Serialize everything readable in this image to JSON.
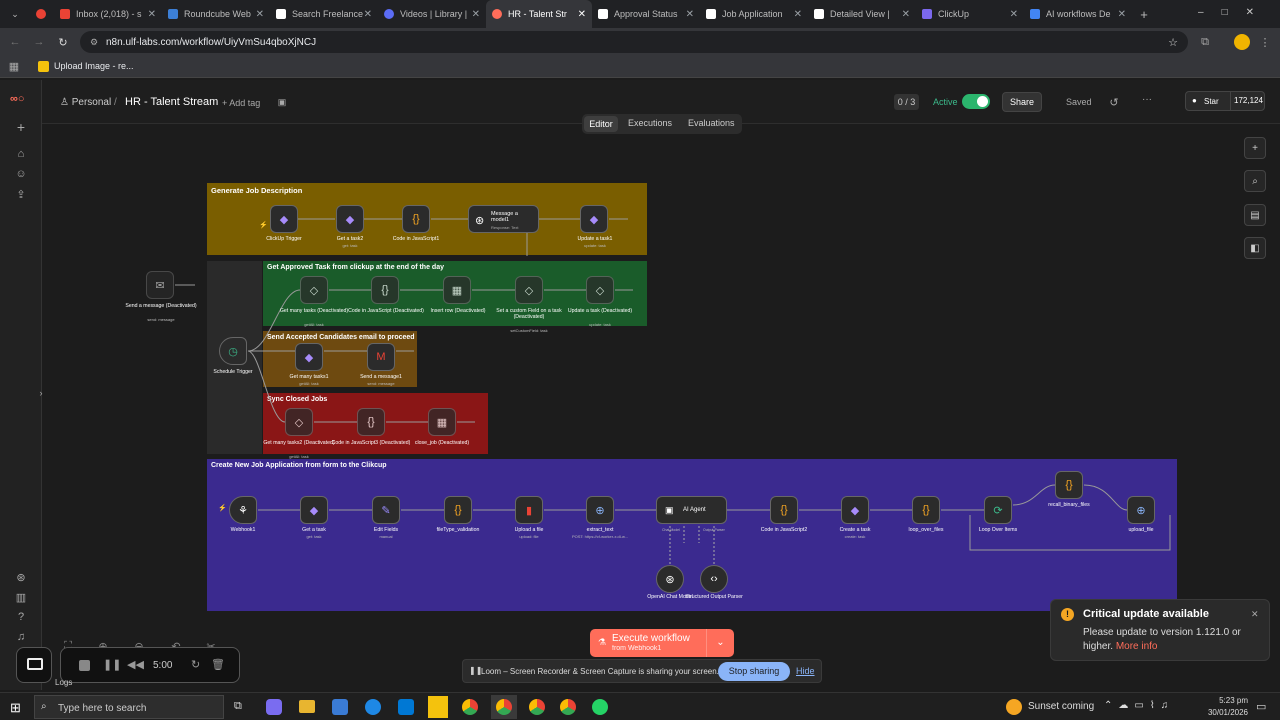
{
  "browser": {
    "tabs": [
      {
        "label": "",
        "color": "#e94235"
      },
      {
        "label": "Inbox (2,018) - s",
        "color": "#ea4335"
      },
      {
        "label": "Roundcube Web",
        "color": "#3c7fd6"
      },
      {
        "label": "Search Freelance",
        "color": "#ffffff"
      },
      {
        "label": "Videos | Library |",
        "color": "#5b6cf5"
      },
      {
        "label": "HR - Talent Str",
        "color": "#ff6d5a"
      },
      {
        "label": "Approval Status",
        "color": "#ffffff"
      },
      {
        "label": "Job Application",
        "color": "#ffffff"
      },
      {
        "label": "Detailed View |",
        "color": "#ffffff"
      },
      {
        "label": "ClickUp",
        "color": "#7b68ee"
      },
      {
        "label": "AI workflows De",
        "color": "#4285f4"
      }
    ],
    "url": "n8n.ulf-labs.com/workflow/UiyVmSu4qboXjNCJ",
    "bookmark": "Upload Image - re..."
  },
  "header": {
    "project": "Personal",
    "sep": "/",
    "workflow": "HR - Talent Stream",
    "add_tag": "+ Add tag",
    "counter": "0 / 3",
    "active": "Active",
    "share": "Share",
    "saved": "Saved",
    "more": "···",
    "star": "Star",
    "stars": "172,124"
  },
  "view_tabs": [
    "Editor",
    "Executions",
    "Evaluations"
  ],
  "groups": {
    "g1": "Generate Job Description",
    "g2": "Get Approved Task from clickup at the end of the day",
    "g3": "Send Accepted Candidates email to proceed",
    "g4": "Sync Closed Jobs",
    "g5": "Create New Job Application from form to the Clikcup"
  },
  "nodes": {
    "clickup_trigger": "ClickUp Trigger",
    "get_task2": "Get a task2",
    "get_task2_sub": "get: task",
    "code_js1": "Code in JavaScript1",
    "message_model": "Message a model1",
    "message_model_sub": "Response: Text",
    "update_task1": "Update a task1",
    "update_task1_sub": "update: task",
    "send_message": "Send a message (Deactivated)",
    "send_message_sub": "send: message",
    "get_many_tasks": "Get many tasks (Deactivated)",
    "get_many_tasks_sub": "getAll: task",
    "code_js": "Code in JavaScript (Deactivated)",
    "insert_row": "Insert row (Deactivated)",
    "set_custom": "Set a custom Field on a task (Deactivated)",
    "set_custom_sub": "setCustomField: task",
    "update_task": "Update a task (Deactivated)",
    "update_task_sub": "update: task",
    "schedule_trigger": "Schedule Trigger",
    "get_many_tasks1": "Get many tasks1",
    "get_many_tasks1_sub": "getAll: task",
    "send_message1": "Send a message1",
    "send_message1_sub": "send: message",
    "get_many_tasks2": "Get many tasks2 (Deactivated)",
    "get_many_tasks2_sub": "getAll: task",
    "code_js3": "Code in JavaScript3 (Deactivated)",
    "close_job": "close_job (Deactivated)",
    "webhook1": "Webhook1",
    "get_task": "Get a task",
    "get_task_sub": "get: task",
    "edit_fields": "Edit Fields",
    "edit_fields_sub": "manual",
    "filetype_validation": "fileType_validation",
    "upload_file": "Upload a file",
    "upload_file_sub": "upload: file",
    "extract_text": "extract_text",
    "extract_text_sub": "POST: https://cf-worker-x.dl-w...",
    "ai_agent": "AI Agent",
    "code_js2": "Code in JavaScript2",
    "create_task": "Create a task",
    "create_task_sub": "create: task",
    "loop_over_files": "loop_over_files",
    "loop_over_items": "Loop Over Items",
    "recall_binary": "recall_binary_files",
    "upload_file2": "upload_file",
    "openai_model": "OpenAI Chat Model",
    "structured_parser": "Structured Output Parser",
    "chat_model_label": "Chat Model",
    "output_parser_label": "Output Parser"
  },
  "execute": {
    "label": "Execute workflow",
    "sub": "from Webhook1"
  },
  "toast": {
    "title": "Critical update available",
    "body": "Please update to version 1.121.0 or higher.",
    "link": "More info"
  },
  "recorder": {
    "time": "5:00"
  },
  "loom": {
    "text": "Loom – Screen Recorder & Screen Capture is sharing your screen.",
    "stop": "Stop sharing",
    "hide": "Hide"
  },
  "logs": "Logs",
  "taskbar": {
    "search": "Type here to search",
    "weather": "Sunset coming",
    "time": "5:23 pm",
    "date": "30/01/2026"
  }
}
